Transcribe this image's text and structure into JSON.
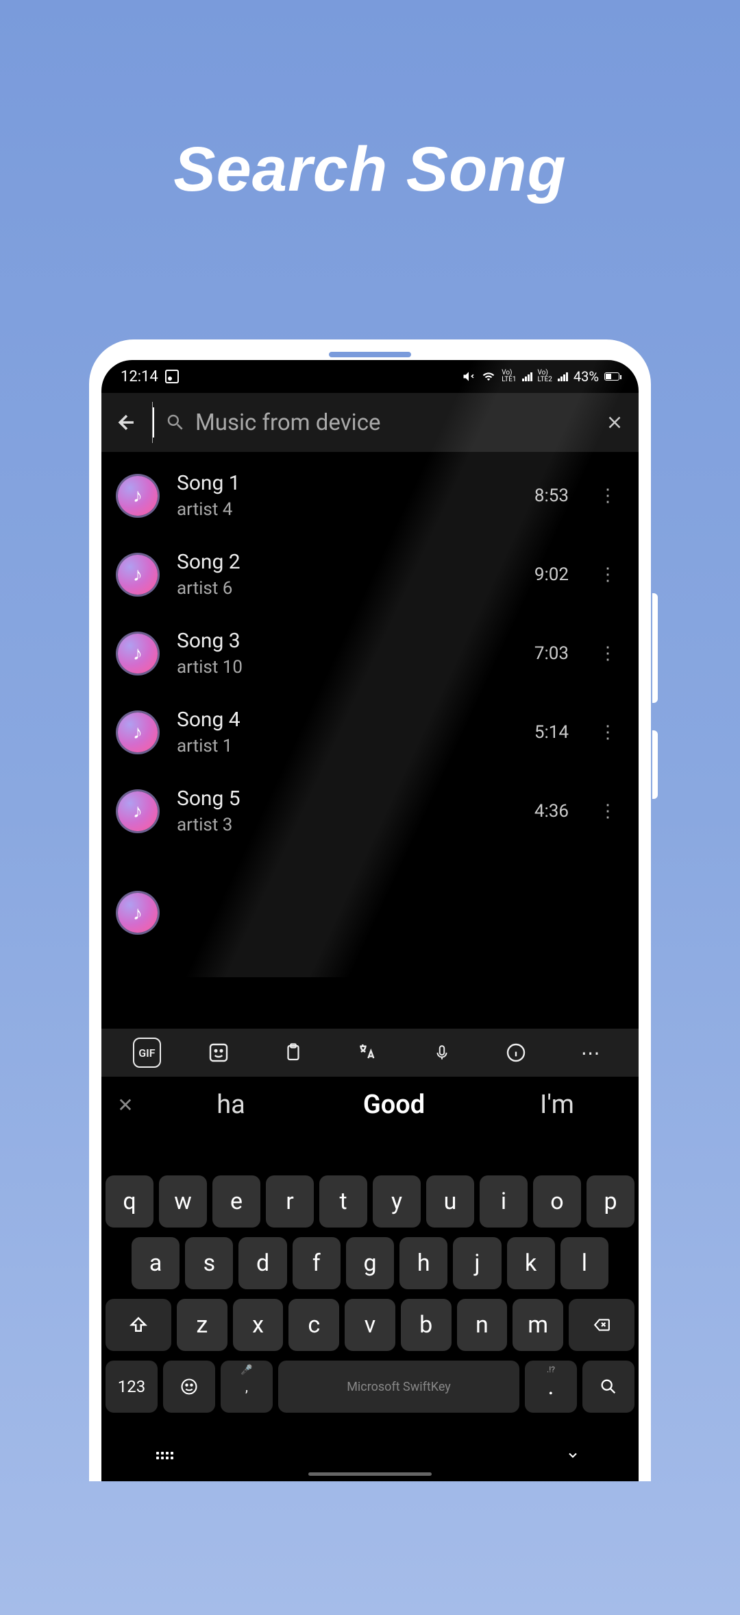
{
  "promo": {
    "title": "Search Song"
  },
  "status": {
    "time": "12:14",
    "battery": "43%",
    "carrier1": "LTE1",
    "carrier2": "LTE2"
  },
  "search": {
    "placeholder": "Music from device"
  },
  "songs": [
    {
      "title": "Song 1",
      "artist": "artist 4",
      "duration": "8:53"
    },
    {
      "title": "Song 2",
      "artist": "artist 6",
      "duration": "9:02"
    },
    {
      "title": "Song 3",
      "artist": "artist 10",
      "duration": "7:03"
    },
    {
      "title": "Song 4",
      "artist": "artist 1",
      "duration": "5:14"
    },
    {
      "title": "Song 5",
      "artist": "artist 3",
      "duration": "4:36"
    }
  ],
  "keyboard": {
    "toolbar": {
      "gif": "GIF"
    },
    "suggestions": [
      "ha",
      "Good",
      "I'm"
    ],
    "row1": [
      "q",
      "w",
      "e",
      "r",
      "t",
      "y",
      "u",
      "i",
      "o",
      "p"
    ],
    "row2": [
      "a",
      "s",
      "d",
      "f",
      "g",
      "h",
      "j",
      "k",
      "l"
    ],
    "row3": [
      "z",
      "x",
      "c",
      "v",
      "b",
      "n",
      "m"
    ],
    "num": "123",
    "comma_hint": "🎤",
    "comma": ",",
    "space": "Microsoft SwiftKey",
    "dot": ".",
    "dot_hint": ".!?"
  }
}
